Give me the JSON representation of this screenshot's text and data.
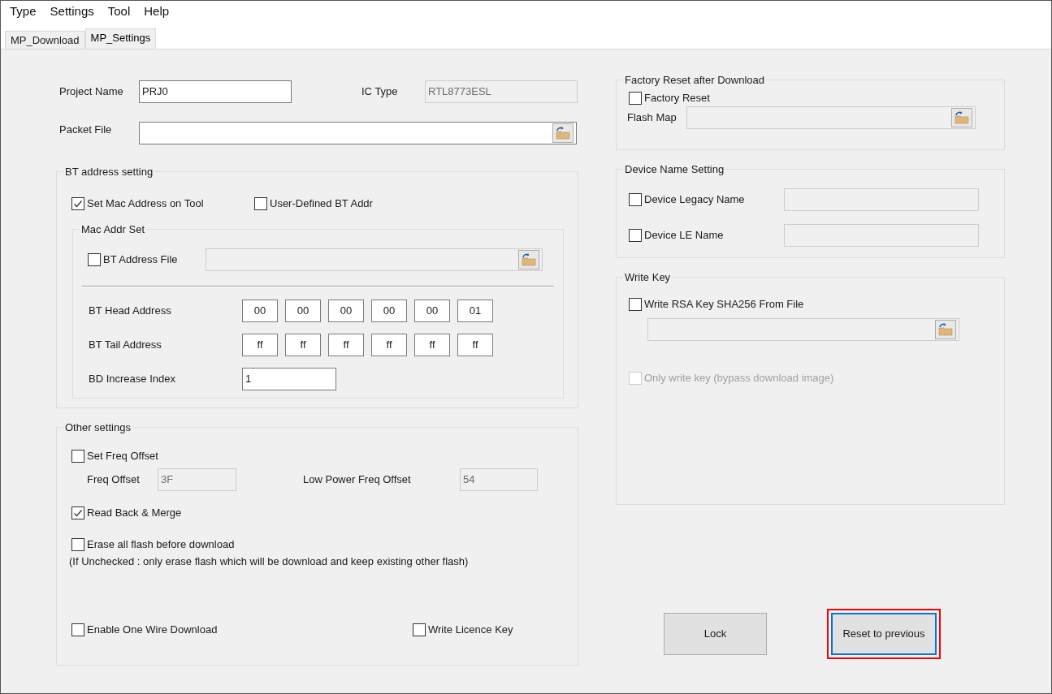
{
  "menu": [
    "Type",
    "Settings",
    "Tool",
    "Help"
  ],
  "tabs": [
    {
      "label": "MP_Download",
      "selected": false
    },
    {
      "label": "MP_Settings",
      "selected": true
    }
  ],
  "project": {
    "name_label": "Project Name",
    "name_field": {
      "value": "PRJ0",
      "disabled": false
    },
    "ic_label": "IC Type",
    "ic_field": {
      "value": "RTL8773ESL",
      "disabled": true
    },
    "packet_label": "Packet File",
    "packet_field": {
      "disabled": false
    }
  },
  "bt_address": {
    "title": "BT address setting",
    "options": [
      {
        "label": "Set Mac Address on Tool",
        "checked": true
      },
      {
        "label": "User-Defined BT Addr",
        "checked": false
      }
    ],
    "mac_group": {
      "title": "Mac Addr Set",
      "file": {
        "label": "BT Address File",
        "checked": false
      },
      "file_field": {
        "disabled": true
      },
      "head": {
        "label": "BT Head Address",
        "bytes": [
          "00",
          "00",
          "00",
          "00",
          "00",
          "01"
        ]
      },
      "tail": {
        "label": "BT Tail Address",
        "bytes": [
          "ff",
          "ff",
          "ff",
          "ff",
          "ff",
          "ff"
        ]
      },
      "index": {
        "label": "BD Increase Index",
        "value": "1"
      }
    }
  },
  "other": {
    "title": "Other settings",
    "set_freq": {
      "label": "Set Freq Offset",
      "checked": false
    },
    "freq_offset": {
      "label": "Freq Offset",
      "value": "3F",
      "disabled": true
    },
    "low_power": {
      "label": "Low Power Freq Offset",
      "value": "54",
      "disabled": true
    },
    "read_back": {
      "label": "Read Back & Merge",
      "checked": true
    },
    "erase": {
      "label": "Erase all flash before download",
      "checked": false
    },
    "note": "(If Unchecked : only erase flash which will be download and keep existing other flash)",
    "one_wire": {
      "label": "Enable One Wire Download",
      "checked": false
    },
    "licence": {
      "label": "Write Licence Key",
      "checked": false
    }
  },
  "factory_reset": {
    "title": "Factory Reset after Download",
    "checkbox": {
      "label": "Factory Reset",
      "checked": false
    },
    "flash_map_label": "Flash Map",
    "flash_map_field": {
      "disabled": true
    }
  },
  "device_name": {
    "title": "Device Name Setting",
    "items": [
      {
        "label": "Device Legacy Name",
        "checked": false,
        "field_disabled": true
      },
      {
        "label": "Device LE Name",
        "checked": false,
        "field_disabled": true
      }
    ]
  },
  "write_key": {
    "title": "Write Key",
    "rsa": {
      "label": "Write RSA Key SHA256 From File",
      "checked": false
    },
    "rsa_field": {
      "disabled": true
    },
    "only": {
      "label": "Only write key (bypass download image)",
      "checked": false,
      "disabled": true
    }
  },
  "buttons": [
    {
      "label": "Lock",
      "focused": false,
      "highlighted": false
    },
    {
      "label": "Reset to previous",
      "focused": true,
      "highlighted": true
    }
  ]
}
